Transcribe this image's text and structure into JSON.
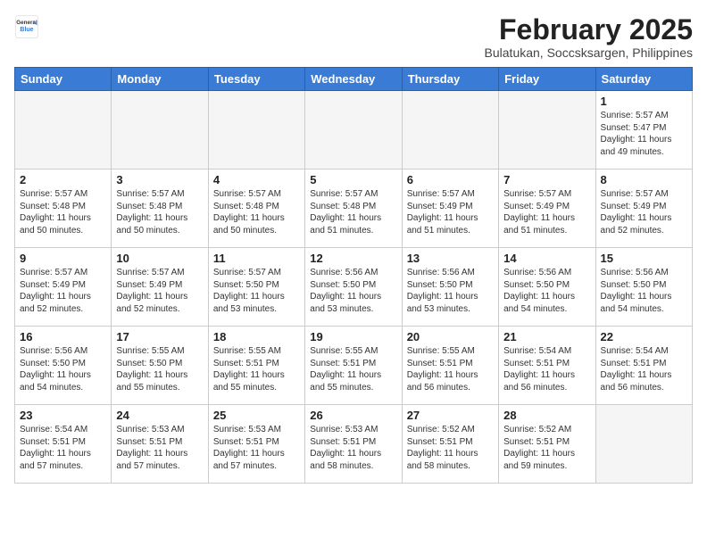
{
  "header": {
    "logo_general": "General",
    "logo_blue": "Blue",
    "month_year": "February 2025",
    "location": "Bulatukan, Soccsksargen, Philippines"
  },
  "weekdays": [
    "Sunday",
    "Monday",
    "Tuesday",
    "Wednesday",
    "Thursday",
    "Friday",
    "Saturday"
  ],
  "weeks": [
    [
      {
        "day": "",
        "info": ""
      },
      {
        "day": "",
        "info": ""
      },
      {
        "day": "",
        "info": ""
      },
      {
        "day": "",
        "info": ""
      },
      {
        "day": "",
        "info": ""
      },
      {
        "day": "",
        "info": ""
      },
      {
        "day": "1",
        "info": "Sunrise: 5:57 AM\nSunset: 5:47 PM\nDaylight: 11 hours and 49 minutes."
      }
    ],
    [
      {
        "day": "2",
        "info": "Sunrise: 5:57 AM\nSunset: 5:48 PM\nDaylight: 11 hours and 50 minutes."
      },
      {
        "day": "3",
        "info": "Sunrise: 5:57 AM\nSunset: 5:48 PM\nDaylight: 11 hours and 50 minutes."
      },
      {
        "day": "4",
        "info": "Sunrise: 5:57 AM\nSunset: 5:48 PM\nDaylight: 11 hours and 50 minutes."
      },
      {
        "day": "5",
        "info": "Sunrise: 5:57 AM\nSunset: 5:48 PM\nDaylight: 11 hours and 51 minutes."
      },
      {
        "day": "6",
        "info": "Sunrise: 5:57 AM\nSunset: 5:49 PM\nDaylight: 11 hours and 51 minutes."
      },
      {
        "day": "7",
        "info": "Sunrise: 5:57 AM\nSunset: 5:49 PM\nDaylight: 11 hours and 51 minutes."
      },
      {
        "day": "8",
        "info": "Sunrise: 5:57 AM\nSunset: 5:49 PM\nDaylight: 11 hours and 52 minutes."
      }
    ],
    [
      {
        "day": "9",
        "info": "Sunrise: 5:57 AM\nSunset: 5:49 PM\nDaylight: 11 hours and 52 minutes."
      },
      {
        "day": "10",
        "info": "Sunrise: 5:57 AM\nSunset: 5:49 PM\nDaylight: 11 hours and 52 minutes."
      },
      {
        "day": "11",
        "info": "Sunrise: 5:57 AM\nSunset: 5:50 PM\nDaylight: 11 hours and 53 minutes."
      },
      {
        "day": "12",
        "info": "Sunrise: 5:56 AM\nSunset: 5:50 PM\nDaylight: 11 hours and 53 minutes."
      },
      {
        "day": "13",
        "info": "Sunrise: 5:56 AM\nSunset: 5:50 PM\nDaylight: 11 hours and 53 minutes."
      },
      {
        "day": "14",
        "info": "Sunrise: 5:56 AM\nSunset: 5:50 PM\nDaylight: 11 hours and 54 minutes."
      },
      {
        "day": "15",
        "info": "Sunrise: 5:56 AM\nSunset: 5:50 PM\nDaylight: 11 hours and 54 minutes."
      }
    ],
    [
      {
        "day": "16",
        "info": "Sunrise: 5:56 AM\nSunset: 5:50 PM\nDaylight: 11 hours and 54 minutes."
      },
      {
        "day": "17",
        "info": "Sunrise: 5:55 AM\nSunset: 5:50 PM\nDaylight: 11 hours and 55 minutes."
      },
      {
        "day": "18",
        "info": "Sunrise: 5:55 AM\nSunset: 5:51 PM\nDaylight: 11 hours and 55 minutes."
      },
      {
        "day": "19",
        "info": "Sunrise: 5:55 AM\nSunset: 5:51 PM\nDaylight: 11 hours and 55 minutes."
      },
      {
        "day": "20",
        "info": "Sunrise: 5:55 AM\nSunset: 5:51 PM\nDaylight: 11 hours and 56 minutes."
      },
      {
        "day": "21",
        "info": "Sunrise: 5:54 AM\nSunset: 5:51 PM\nDaylight: 11 hours and 56 minutes."
      },
      {
        "day": "22",
        "info": "Sunrise: 5:54 AM\nSunset: 5:51 PM\nDaylight: 11 hours and 56 minutes."
      }
    ],
    [
      {
        "day": "23",
        "info": "Sunrise: 5:54 AM\nSunset: 5:51 PM\nDaylight: 11 hours and 57 minutes."
      },
      {
        "day": "24",
        "info": "Sunrise: 5:53 AM\nSunset: 5:51 PM\nDaylight: 11 hours and 57 minutes."
      },
      {
        "day": "25",
        "info": "Sunrise: 5:53 AM\nSunset: 5:51 PM\nDaylight: 11 hours and 57 minutes."
      },
      {
        "day": "26",
        "info": "Sunrise: 5:53 AM\nSunset: 5:51 PM\nDaylight: 11 hours and 58 minutes."
      },
      {
        "day": "27",
        "info": "Sunrise: 5:52 AM\nSunset: 5:51 PM\nDaylight: 11 hours and 58 minutes."
      },
      {
        "day": "28",
        "info": "Sunrise: 5:52 AM\nSunset: 5:51 PM\nDaylight: 11 hours and 59 minutes."
      },
      {
        "day": "",
        "info": ""
      }
    ]
  ]
}
